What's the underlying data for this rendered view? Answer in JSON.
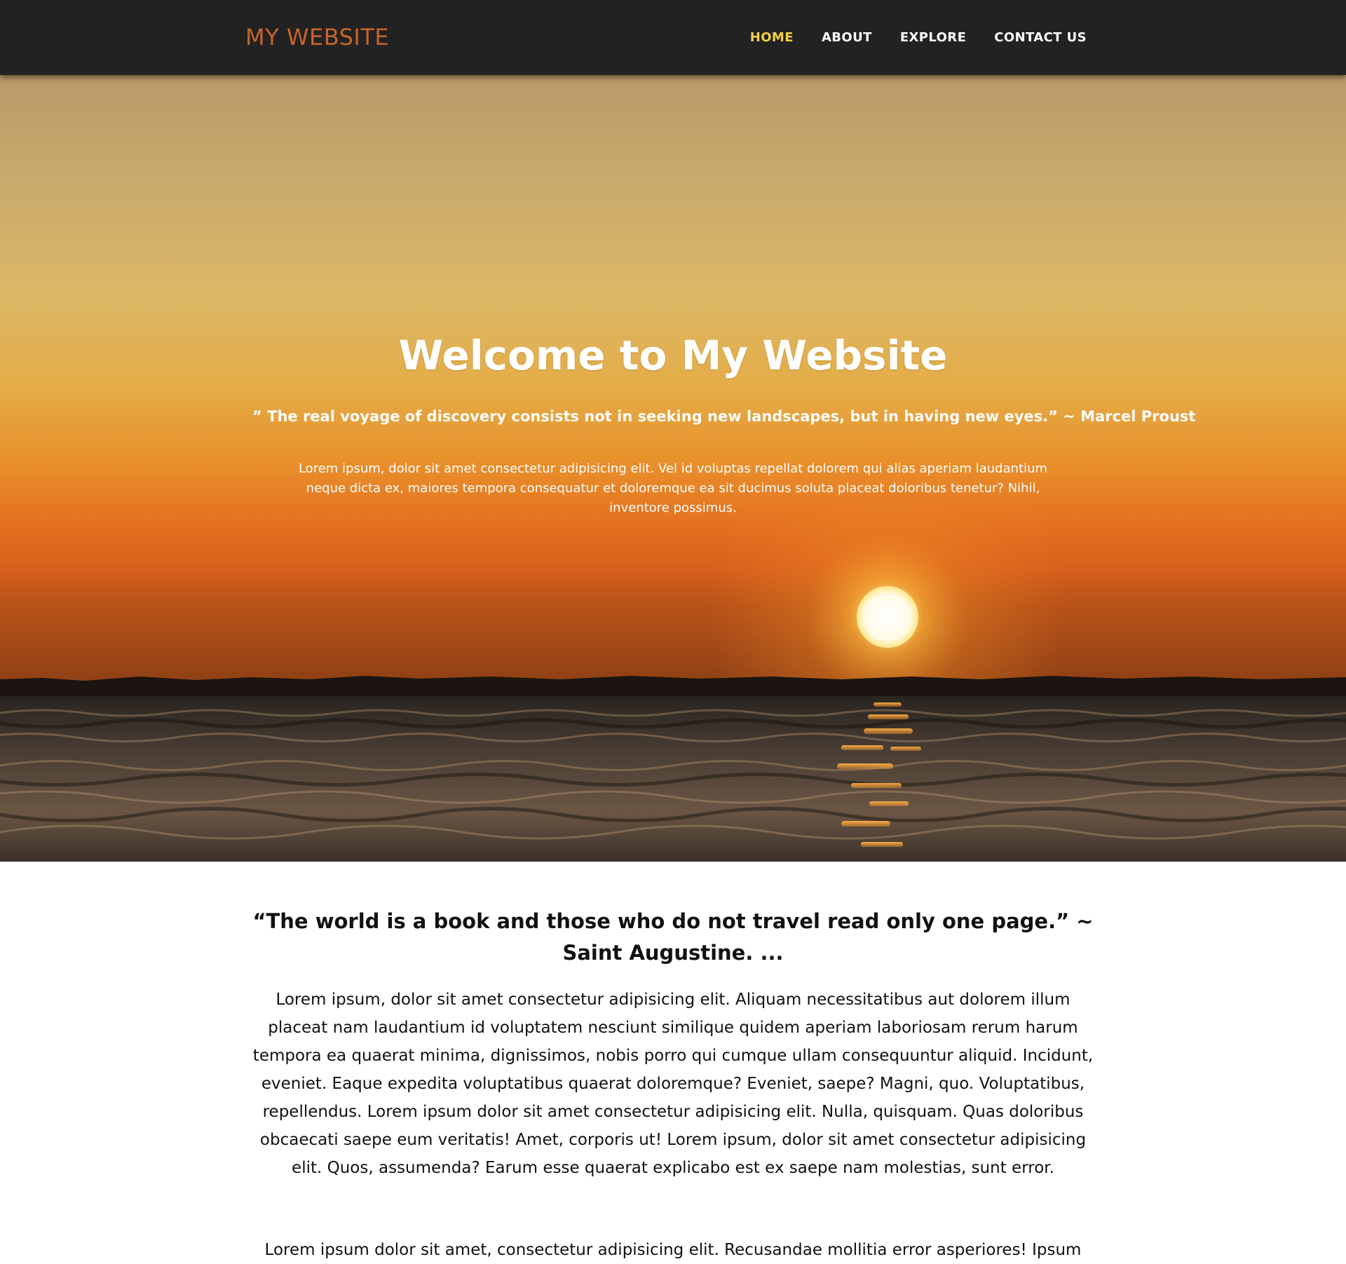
{
  "colors": {
    "navbar_bg": "#222222",
    "brand": "#c8642a",
    "nav_active": "#f4d03f",
    "nav_default": "#ffffff"
  },
  "navbar": {
    "brand": "MY WEBSITE",
    "links": [
      {
        "label": "HOME",
        "active": true
      },
      {
        "label": "ABOUT",
        "active": false
      },
      {
        "label": "EXPLORE",
        "active": false
      },
      {
        "label": "CONTACT US",
        "active": false
      }
    ]
  },
  "hero": {
    "title": "Welcome to My Website",
    "quote": "” The real voyage of discovery consists not in seeking new landscapes, but in having new eyes.” ~ Marcel Proust",
    "text": "Lorem ipsum, dolor sit amet consectetur adipisicing elit. Vel id voluptas repellat dolorem qui alias aperiam laudantium neque dicta ex, maiores tempora consequatur et doloremque ea sit ducimus soluta placeat doloribus tenetur? Nihil, inventore possimus."
  },
  "content": {
    "quote": "“The world is a book and those who do not travel read only one page.” ~ Saint Augustine. ...",
    "paragraphs": [
      "Lorem ipsum, dolor sit amet consectetur adipisicing elit. Aliquam necessitatibus aut dolorem illum placeat nam laudantium id voluptatem nesciunt similique quidem aperiam laboriosam rerum harum tempora ea quaerat minima, dignissimos, nobis porro qui cumque ullam consequuntur aliquid. Incidunt, eveniet. Eaque expedita voluptatibus quaerat doloremque? Eveniet, saepe? Magni, quo. Voluptatibus, repellendus. Lorem ipsum dolor sit amet consectetur adipisicing elit. Nulla, quisquam. Quas doloribus obcaecati saepe eum veritatis! Amet, corporis ut! Lorem ipsum, dolor sit amet consectetur adipisicing elit. Quos, assumenda? Earum esse quaerat explicabo est ex saepe nam molestias, sunt error.",
      "Lorem ipsum dolor sit amet, consectetur adipisicing elit. Recusandae mollitia error asperiores! Ipsum"
    ]
  }
}
